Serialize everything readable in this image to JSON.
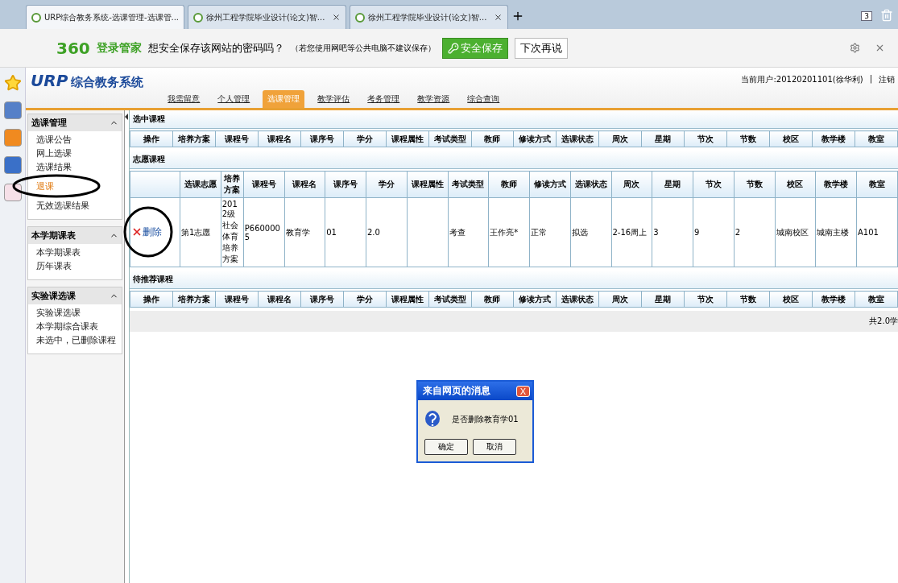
{
  "browser": {
    "tabs": [
      {
        "title": "URP综合教务系统-选课管理-选课管...",
        "selected": true
      },
      {
        "title": "徐州工程学院毕业设计(论文)智...",
        "selected": false
      },
      {
        "title": "徐州工程学院毕业设计(论文)智...",
        "selected": false
      }
    ],
    "tab_count": "3"
  },
  "password_bar": {
    "brand": "360",
    "brand_name": "登录管家",
    "prompt": "想安全保存该网站的密码吗？",
    "hint": "（若您使用网吧等公共电脑不建议保存）",
    "save": "安全保存",
    "later": "下次再说"
  },
  "header": {
    "logo": "URP",
    "logo_text": "综合教务系统",
    "user": "当前用户:20120201101(徐华利)",
    "separator": "|",
    "logout": "注销",
    "nav": [
      {
        "label": "我需留意",
        "selected": false
      },
      {
        "label": "个人管理",
        "selected": false
      },
      {
        "label": "选课管理",
        "selected": true
      },
      {
        "label": "教学评估",
        "selected": false
      },
      {
        "label": "考务管理",
        "selected": false
      },
      {
        "label": "教学资源",
        "selected": false
      },
      {
        "label": "综合查询",
        "selected": false
      }
    ]
  },
  "sidebar": {
    "groups": [
      {
        "title": "选课管理",
        "expanded": true,
        "items": [
          {
            "label": "选课公告",
            "selected": false
          },
          {
            "label": "网上选课",
            "selected": false
          },
          {
            "label": "选课结果",
            "selected": false
          },
          {
            "label": "退课",
            "selected": true
          },
          {
            "label": "无效选课结果",
            "selected": false
          }
        ]
      },
      {
        "title": "本学期课表",
        "expanded": true,
        "items": [
          {
            "label": "本学期课表",
            "selected": false
          },
          {
            "label": "历年课表",
            "selected": false
          }
        ]
      },
      {
        "title": "实验课选课",
        "expanded": true,
        "items": [
          {
            "label": "实验课选课",
            "selected": false
          },
          {
            "label": "本学期综合课表",
            "selected": false
          },
          {
            "label": "未选中，已删除课程",
            "selected": false
          }
        ]
      }
    ]
  },
  "sections": [
    {
      "title": "选中课程",
      "columns": [
        "操作",
        "培养方案",
        "课程号",
        "课程名",
        "课序号",
        "学分",
        "课程属性",
        "考试类型",
        "教师",
        "修读方式",
        "选课状态",
        "周次",
        "星期",
        "节次",
        "节数",
        "校区",
        "教学楼",
        "教室"
      ]
    },
    {
      "title": "志愿课程",
      "columns": [
        "",
        "选课志愿",
        "培养方案",
        "课程号",
        "课程名",
        "课序号",
        "学分",
        "课程属性",
        "考试类型",
        "教师",
        "修读方式",
        "选课状态",
        "周次",
        "星期",
        "节次",
        "节数",
        "校区",
        "教学楼",
        "教室"
      ],
      "rows": [
        {
          "cells": [
            "删除",
            "第1志愿",
            "2012级社会体育培养方案",
            "P6600005",
            "教育学",
            "01",
            "2.0",
            "",
            "考查",
            "王作亮*",
            "正常",
            "拟选",
            "2-16周上",
            "3",
            "9",
            "2",
            "城南校区",
            "城南主楼",
            "A101"
          ]
        }
      ]
    },
    {
      "title": "待推荐课程",
      "columns": [
        "操作",
        "培养方案",
        "课程号",
        "课程名",
        "课序号",
        "学分",
        "课程属性",
        "考试类型",
        "教师",
        "修读方式",
        "选课状态",
        "周次",
        "星期",
        "节次",
        "节数",
        "校区",
        "教学楼",
        "教室"
      ]
    }
  ],
  "total": "共2.0学",
  "dialog": {
    "title": "来自网页的消息",
    "close": "X",
    "message": "是否删除教育学01",
    "ok": "确定",
    "cancel": "取消"
  }
}
